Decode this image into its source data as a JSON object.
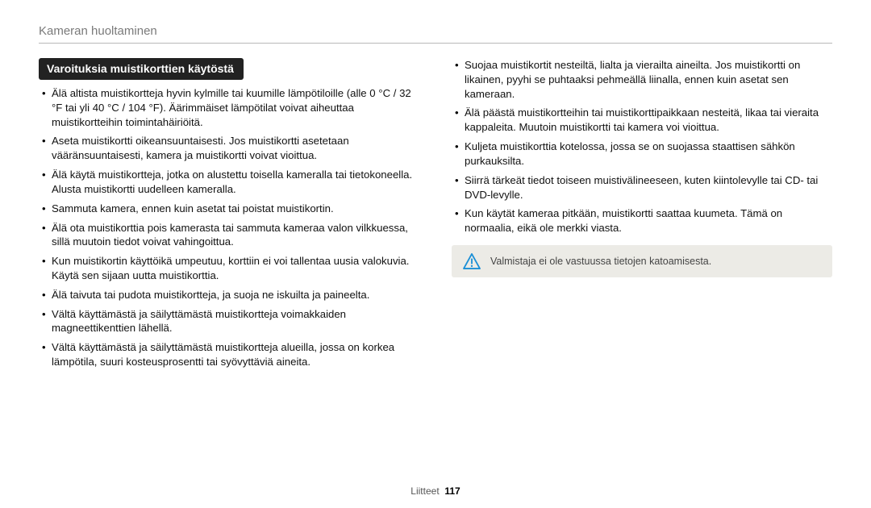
{
  "breadcrumb": "Kameran huoltaminen",
  "section_title": "Varoituksia muistikorttien käytöstä",
  "left_bullets": [
    "Älä altista muistikortteja hyvin kylmille tai kuumille lämpötiloille (alle 0 °C / 32 °F tai yli 40 °C / 104 °F). Äärimmäiset lämpötilat voivat aiheuttaa muistikortteihin toimintahäiriöitä.",
    "Aseta muistikortti oikeansuuntaisesti. Jos muistikortti asetetaan vääränsuuntaisesti, kamera ja muistikortti voivat vioittua.",
    "Älä käytä muistikortteja, jotka on alustettu toisella kameralla tai tietokoneella. Alusta muistikortti uudelleen kameralla.",
    "Sammuta kamera, ennen kuin asetat tai poistat muistikortin.",
    "Älä ota muistikorttia pois kamerasta tai sammuta kameraa valon vilkkuessa, sillä muutoin tiedot voivat vahingoittua.",
    "Kun muistikortin käyttöikä umpeutuu, korttiin ei voi tallentaa uusia valokuvia. Käytä sen sijaan uutta muistikorttia.",
    "Älä taivuta tai pudota muistikortteja, ja suoja ne iskuilta ja paineelta.",
    "Vältä käyttämästä ja säilyttämästä muistikortteja voimakkaiden magneettikenttien lähellä.",
    "Vältä käyttämästä ja säilyttämästä muistikortteja alueilla, jossa on korkea lämpötila, suuri kosteusprosentti tai syövyttäviä aineita."
  ],
  "right_bullets": [
    "Suojaa muistikortit nesteiltä, lialta ja vierailta aineilta. Jos muistikortti on likainen, pyyhi se puhtaaksi pehmeällä liinalla, ennen kuin asetat sen kameraan.",
    "Älä päästä muistikortteihin tai muistikorttipaikkaan nesteitä, likaa tai vieraita kappaleita. Muutoin muistikortti tai kamera voi vioittua.",
    "Kuljeta muistikorttia kotelossa, jossa se on suojassa staattisen sähkön purkauksilta.",
    "Siirrä tärkeät tiedot toiseen muistivälineeseen, kuten kiintolevylle tai CD- tai DVD-levylle.",
    "Kun käytät kameraa pitkään, muistikortti saattaa kuumeta. Tämä on normaalia, eikä ole merkki viasta."
  ],
  "note_text": "Valmistaja ei ole vastuussa tietojen katoamisesta.",
  "footer": {
    "section": "Liitteet",
    "page": "117"
  }
}
